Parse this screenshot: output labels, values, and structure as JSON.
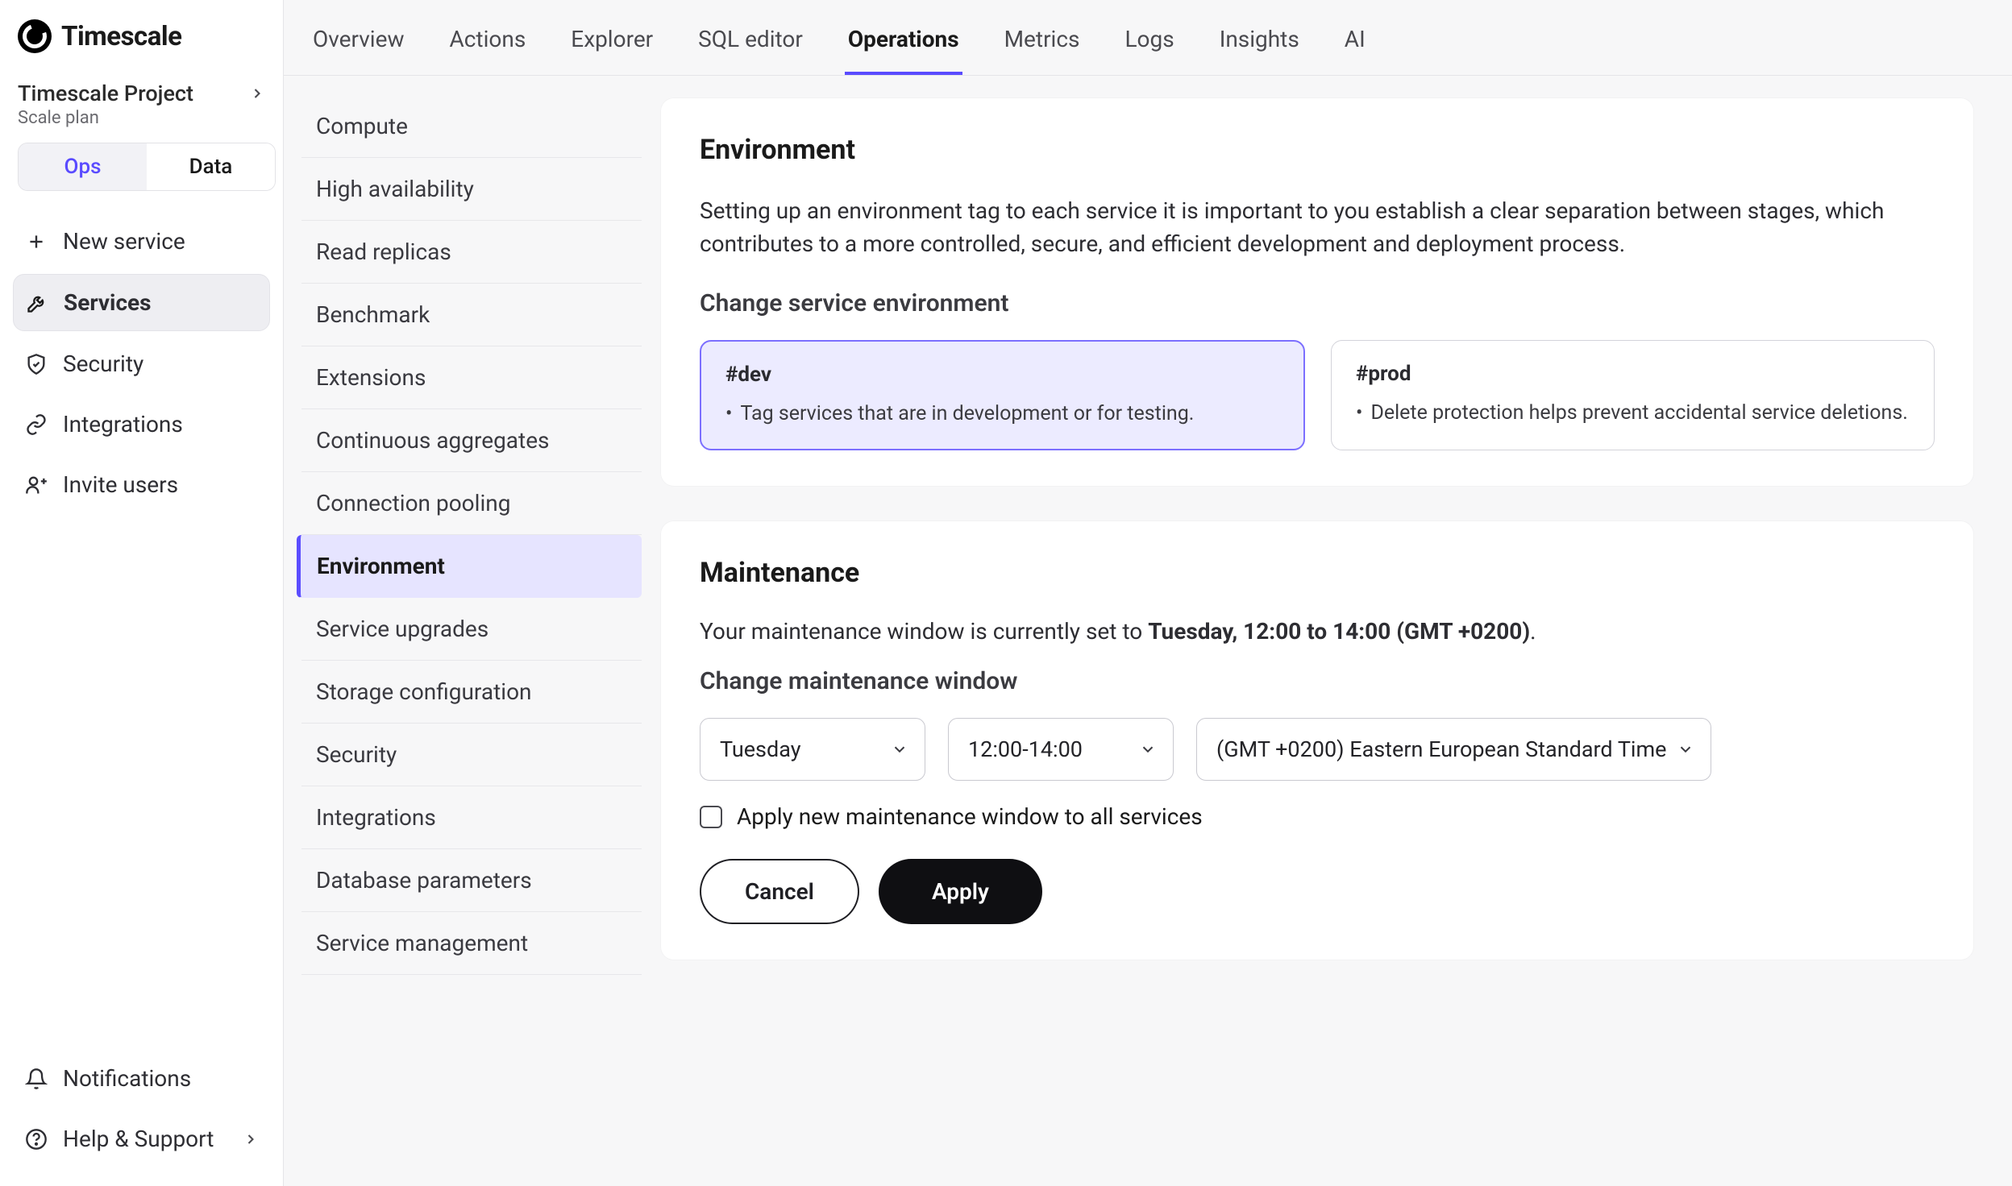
{
  "brand": {
    "name": "Timescale"
  },
  "project": {
    "name": "Timescale Project",
    "plan": "Scale plan"
  },
  "mode": {
    "ops": "Ops",
    "data": "Data"
  },
  "sidebar": {
    "new_service": "New service",
    "items": [
      {
        "label": "Services"
      },
      {
        "label": "Security"
      },
      {
        "label": "Integrations"
      },
      {
        "label": "Invite users"
      }
    ],
    "notifications": "Notifications",
    "help": "Help & Support"
  },
  "tabs": [
    {
      "label": "Overview"
    },
    {
      "label": "Actions"
    },
    {
      "label": "Explorer"
    },
    {
      "label": "SQL editor"
    },
    {
      "label": "Operations"
    },
    {
      "label": "Metrics"
    },
    {
      "label": "Logs"
    },
    {
      "label": "Insights"
    },
    {
      "label": "AI"
    }
  ],
  "subnav": [
    "Compute",
    "High availability",
    "Read replicas",
    "Benchmark",
    "Extensions",
    "Continuous aggregates",
    "Connection pooling",
    "Environment",
    "Service upgrades",
    "Storage configuration",
    "Security",
    "Integrations",
    "Database parameters",
    "Service management"
  ],
  "environment": {
    "heading": "Environment",
    "description": "Setting up an environment tag to each service it is important to you establish a clear separation between stages, which contributes to a more controlled, secure, and efficient development and deployment process.",
    "change_heading": "Change service environment",
    "dev": {
      "tag": "#dev",
      "desc": "Tag services that are in development or for testing."
    },
    "prod": {
      "tag": "#prod",
      "desc": "Delete protection helps prevent accidental service deletions."
    }
  },
  "maintenance": {
    "heading": "Maintenance",
    "current_prefix": "Your maintenance window is currently set to ",
    "current_value": "Tuesday, 12:00 to 14:00 (GMT +0200)",
    "current_suffix": ".",
    "change_heading": "Change maintenance window",
    "day": "Tuesday",
    "time": "12:00-14:00",
    "tz": "(GMT +0200) Eastern European Standard Time",
    "apply_all_label": "Apply new maintenance window to all services",
    "cancel": "Cancel",
    "apply": "Apply"
  }
}
